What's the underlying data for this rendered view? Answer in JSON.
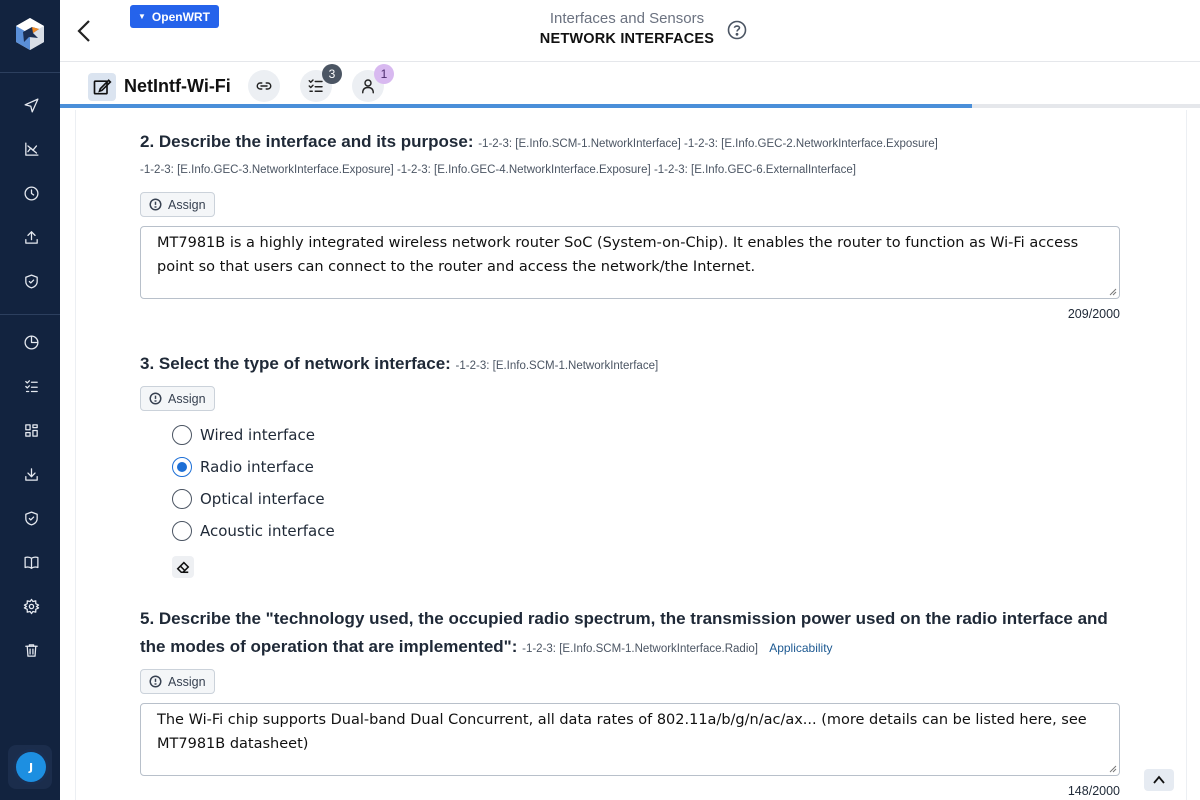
{
  "header": {
    "project_badge": "OpenWRT",
    "subtitle": "Interfaces and Sensors",
    "title": "NETWORK INTERFACES"
  },
  "subheader": {
    "item_title": "NetIntf-Wi-Fi",
    "checklist_count": "3",
    "users_count": "1",
    "progress": 0.8
  },
  "user": {
    "initial": "J"
  },
  "q2": {
    "title": "2. Describe the interface and its purpose:",
    "refs_line1": [
      {
        "pre": "-1-2-3:",
        "ref": "[E.Info.SCM-1.NetworkInterface]"
      },
      {
        "pre": "-1-2-3:",
        "ref": "[E.Info.GEC-2.NetworkInterface.Exposure]"
      }
    ],
    "refs_line2": [
      {
        "pre": "-1-2-3:",
        "ref": "[E.Info.GEC-3.NetworkInterface.Exposure]"
      },
      {
        "pre": "-1-2-3:",
        "ref": "[E.Info.GEC-4.NetworkInterface.Exposure]"
      },
      {
        "pre": "-1-2-3:",
        "ref": "[E.Info.GEC-6.ExternalInterface]"
      }
    ],
    "assign_label": "Assign",
    "answer": "MT7981B is a highly integrated wireless network router SoC (System-on-Chip). It enables the router to function as Wi-Fi access point so that users can connect to the router and access the network/the Internet.",
    "char_count": "209/2000"
  },
  "q3": {
    "title": "3. Select the type of network interface:",
    "ref_pre": "-1-2-3:",
    "ref": "[E.Info.SCM-1.NetworkInterface]",
    "assign_label": "Assign",
    "options": [
      "Wired interface",
      "Radio interface",
      "Optical interface",
      "Acoustic interface"
    ],
    "selected": "Radio interface"
  },
  "q5": {
    "title_line1": "5. Describe the \"technology used, the occupied radio spectrum, the transmission power used on the radio interface and",
    "title_line2": "the modes of operation that are implemented\":",
    "ref_pre": "-1-2-3:",
    "ref": "[E.Info.SCM-1.NetworkInterface.Radio]",
    "applicability": "Applicability",
    "assign_label": "Assign",
    "answer": "The Wi-Fi chip supports Dual-band Dual Concurrent, all data rates of 802.11a/b/g/n/ac/ax... (more details can be listed here, see MT7981B datasheet)",
    "char_count": "148/2000"
  },
  "colors": {
    "sidebar": "#12233f",
    "accent": "#2563eb",
    "radio_selected": "#1d6fd6"
  }
}
